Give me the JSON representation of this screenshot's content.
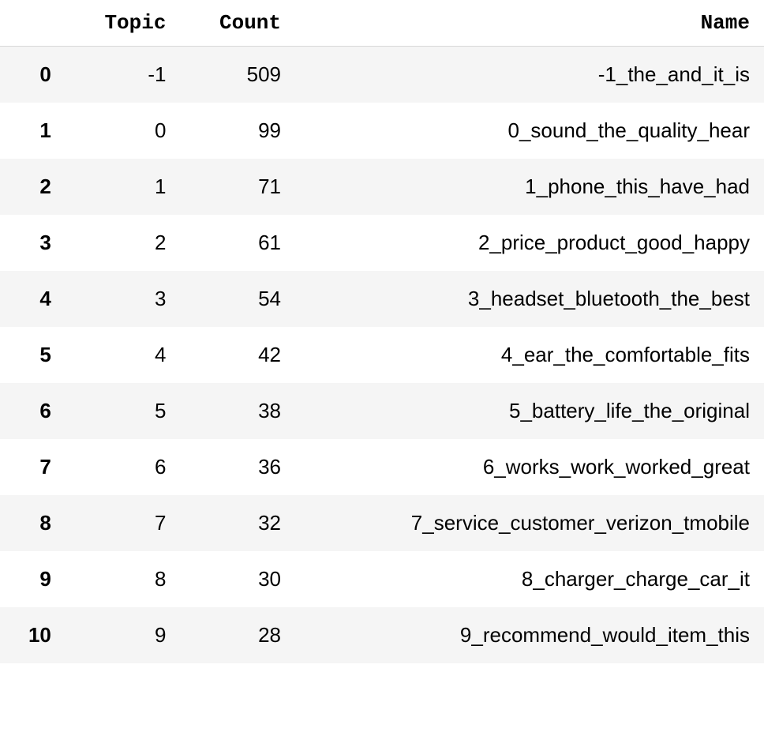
{
  "table": {
    "columns": [
      "Topic",
      "Count",
      "Name"
    ],
    "rows": [
      {
        "index": "0",
        "topic": "-1",
        "count": "509",
        "name": "-1_the_and_it_is"
      },
      {
        "index": "1",
        "topic": "0",
        "count": "99",
        "name": "0_sound_the_quality_hear"
      },
      {
        "index": "2",
        "topic": "1",
        "count": "71",
        "name": "1_phone_this_have_had"
      },
      {
        "index": "3",
        "topic": "2",
        "count": "61",
        "name": "2_price_product_good_happy"
      },
      {
        "index": "4",
        "topic": "3",
        "count": "54",
        "name": "3_headset_bluetooth_the_best"
      },
      {
        "index": "5",
        "topic": "4",
        "count": "42",
        "name": "4_ear_the_comfortable_fits"
      },
      {
        "index": "6",
        "topic": "5",
        "count": "38",
        "name": "5_battery_life_the_original"
      },
      {
        "index": "7",
        "topic": "6",
        "count": "36",
        "name": "6_works_work_worked_great"
      },
      {
        "index": "8",
        "topic": "7",
        "count": "32",
        "name": "7_service_customer_verizon_tmobile"
      },
      {
        "index": "9",
        "topic": "8",
        "count": "30",
        "name": "8_charger_charge_car_it"
      },
      {
        "index": "10",
        "topic": "9",
        "count": "28",
        "name": "9_recommend_would_item_this"
      }
    ]
  }
}
